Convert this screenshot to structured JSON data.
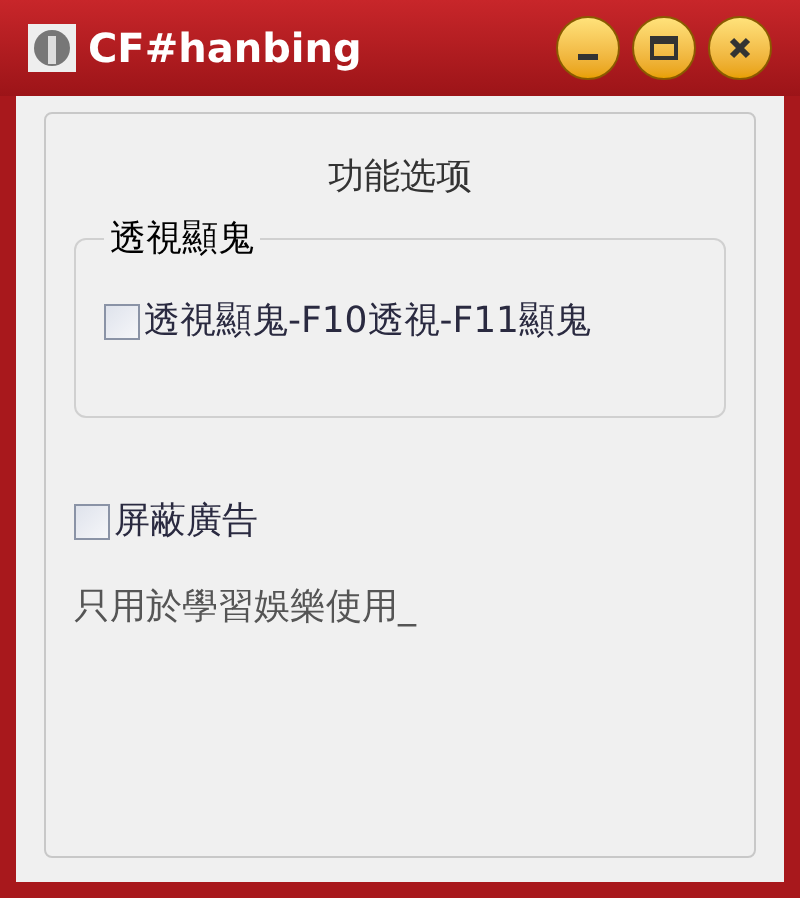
{
  "window": {
    "title": "CF#hanbing"
  },
  "panel": {
    "title": "功能选项"
  },
  "group": {
    "legend": "透視顯鬼",
    "options": [
      {
        "label": "透視顯鬼-F10透視-F11顯鬼",
        "checked": false
      }
    ]
  },
  "options": [
    {
      "label": "屏蔽廣告",
      "checked": false
    }
  ],
  "note": "只用於學習娛樂使用_"
}
